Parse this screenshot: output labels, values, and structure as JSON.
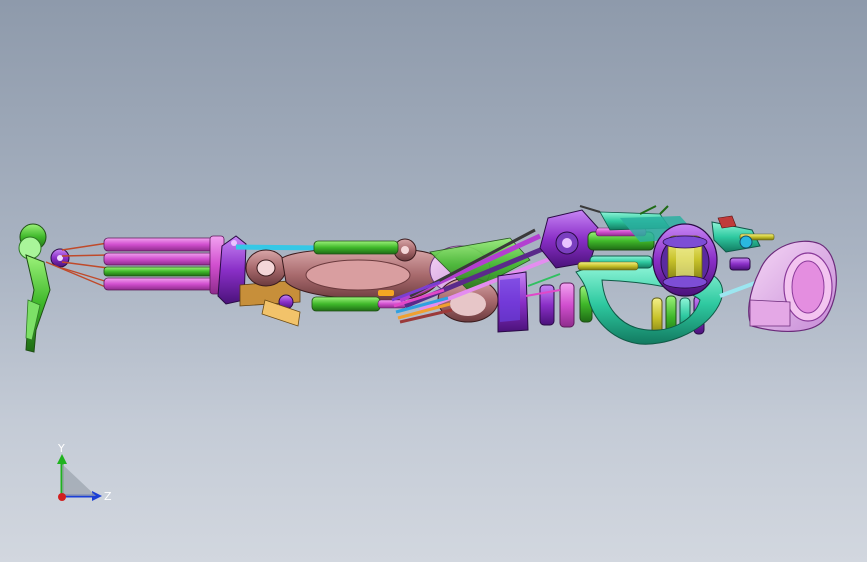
{
  "viewport": {
    "background_top": "#8e9aab",
    "background_bottom": "#d2d7df"
  },
  "triad": {
    "y_label": "Y",
    "z_label": "Z",
    "y_color": "#1fb31f",
    "z_color": "#1b3fd6",
    "x_color": "#d11f1f"
  },
  "model": {
    "name_icon": "robotic-arm-assembly-icon"
  }
}
